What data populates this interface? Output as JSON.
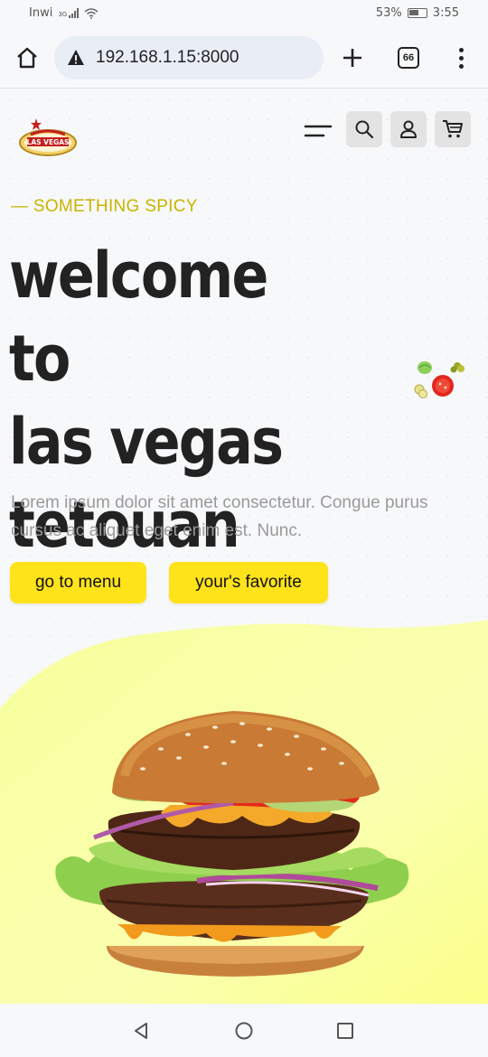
{
  "status_bar": {
    "carrier": "Inwi",
    "network": "3G",
    "battery": "53%",
    "time": "3:55",
    "icons": [
      "signal-icon",
      "wifi-icon",
      "battery-icon"
    ]
  },
  "browser": {
    "url": "192.168.1.15:8000",
    "tab_count": "66",
    "icons": [
      "home-icon",
      "warning-icon",
      "new-tab-icon",
      "more-menu-icon"
    ]
  },
  "site": {
    "logo_text": "LAS VEGAS",
    "nav_icons": [
      "hamburger-icon",
      "search-icon",
      "user-icon",
      "cart-icon"
    ],
    "eyebrow": "— SOMETHING SPICY",
    "title_lines": [
      "welcome to",
      "las vegas",
      "tetouan"
    ],
    "description": "Lorem ipsum dolor sit amet consectetur. Congue purus cursus ac aliquet eget enim est. Nunc.",
    "primary_button": "go to menu",
    "secondary_button": "your's favorite"
  },
  "colors": {
    "accent_yellow": "#ffe31a",
    "eyebrow_color": "#c8b400",
    "background": "#f7f8fa",
    "heading": "#222222",
    "muted_text": "#9a9a9a"
  },
  "system_nav": {
    "icons": [
      "back-icon",
      "home-circle-icon",
      "recent-apps-icon"
    ]
  }
}
